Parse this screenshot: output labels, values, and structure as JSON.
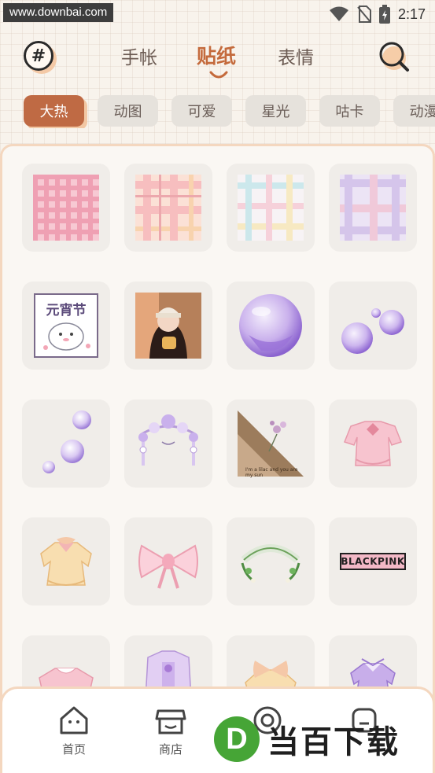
{
  "status_bar": {
    "watermark": "www.downbai.com",
    "time": "2:17"
  },
  "header": {
    "hash_symbol": "#",
    "tabs": [
      {
        "label": "手帐",
        "active": false
      },
      {
        "label": "贴纸",
        "active": true
      },
      {
        "label": "表情",
        "active": false
      }
    ]
  },
  "categories": [
    {
      "label": "大热",
      "active": true
    },
    {
      "label": "动图",
      "active": false
    },
    {
      "label": "可爱",
      "active": false
    },
    {
      "label": "星光",
      "active": false
    },
    {
      "label": "咕卡",
      "active": false
    },
    {
      "label": "动漫",
      "active": false
    }
  ],
  "stickers": [
    {
      "name": "pink-gingham",
      "icon": "pink-plaid-pattern"
    },
    {
      "name": "peach-plaid",
      "icon": "peach-plaid-pattern"
    },
    {
      "name": "pastel-plaid",
      "icon": "pastel-plaid-pattern"
    },
    {
      "name": "lilac-plaid",
      "icon": "lilac-plaid-pattern"
    },
    {
      "name": "lantern-festival",
      "icon": "lantern-festival-sticker",
      "text": "元宵节"
    },
    {
      "name": "girl-photo",
      "icon": "girl-photo-sticker"
    },
    {
      "name": "purple-bubble",
      "icon": "purple-bubble-sticker"
    },
    {
      "name": "twin-bubbles",
      "icon": "twin-bubbles-sticker"
    },
    {
      "name": "floating-bubbles",
      "icon": "floating-bubbles-sticker"
    },
    {
      "name": "flower-headpiece",
      "icon": "flower-headpiece-sticker"
    },
    {
      "name": "lilac-photo",
      "icon": "lilac-photo-sticker",
      "text": "I'm a lilac and you are my sun"
    },
    {
      "name": "pink-dress",
      "icon": "pink-dress-sticker"
    },
    {
      "name": "yellow-dress",
      "icon": "yellow-dress-sticker"
    },
    {
      "name": "pink-bow",
      "icon": "pink-bow-sticker"
    },
    {
      "name": "floral-arch",
      "icon": "floral-arch-sticker"
    },
    {
      "name": "blackpink",
      "icon": "blackpink-sticker",
      "text": "BLACKPINK"
    },
    {
      "name": "pink-top",
      "icon": "pink-top-sticker"
    },
    {
      "name": "purple-outfit",
      "icon": "purple-outfit-sticker"
    },
    {
      "name": "yellow-bow-outfit",
      "icon": "yellow-bow-outfit-sticker"
    },
    {
      "name": "purple-dress",
      "icon": "purple-dress-sticker"
    }
  ],
  "bottom_nav": [
    {
      "label": "首页",
      "icon": "home-icon"
    },
    {
      "label": "商店",
      "icon": "store-icon"
    },
    {
      "label": "",
      "icon": "camera-icon"
    },
    {
      "label": "",
      "icon": "profile-icon"
    }
  ],
  "overlay_logo": {
    "letter": "D",
    "text": "当百下载"
  },
  "colors": {
    "accent": "#bf6a44",
    "chip_bg": "#e6e2dc",
    "panel_border": "#f4d7bf"
  }
}
